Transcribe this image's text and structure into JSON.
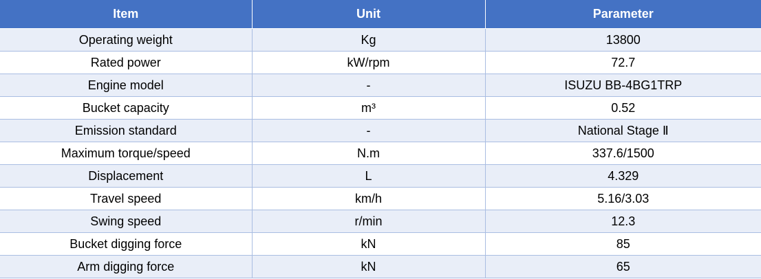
{
  "table": {
    "headers": [
      "Item",
      "Unit",
      "Parameter"
    ],
    "rows": [
      [
        "Operating weight",
        "Kg",
        "13800"
      ],
      [
        "Rated power",
        "kW/rpm",
        "72.7"
      ],
      [
        "Engine model",
        "-",
        "ISUZU BB-4BG1TRP"
      ],
      [
        "Bucket capacity",
        "m³",
        "0.52"
      ],
      [
        "Emission standard",
        "-",
        "National Stage Ⅱ"
      ],
      [
        "Maximum torque/speed",
        "N.m",
        "337.6/1500"
      ],
      [
        "Displacement",
        "L",
        "4.329"
      ],
      [
        "Travel speed",
        "km/h",
        "5.16/3.03"
      ],
      [
        "Swing speed",
        "r/min",
        "12.3"
      ],
      [
        "Bucket digging force",
        "kN",
        "85"
      ],
      [
        "Arm digging force",
        "kN",
        "65"
      ]
    ]
  },
  "colors": {
    "header_bg": "#4472c4",
    "header_text": "#ffffff",
    "row_alt_bg": "#e9eef8",
    "border": "#a9bde2"
  }
}
